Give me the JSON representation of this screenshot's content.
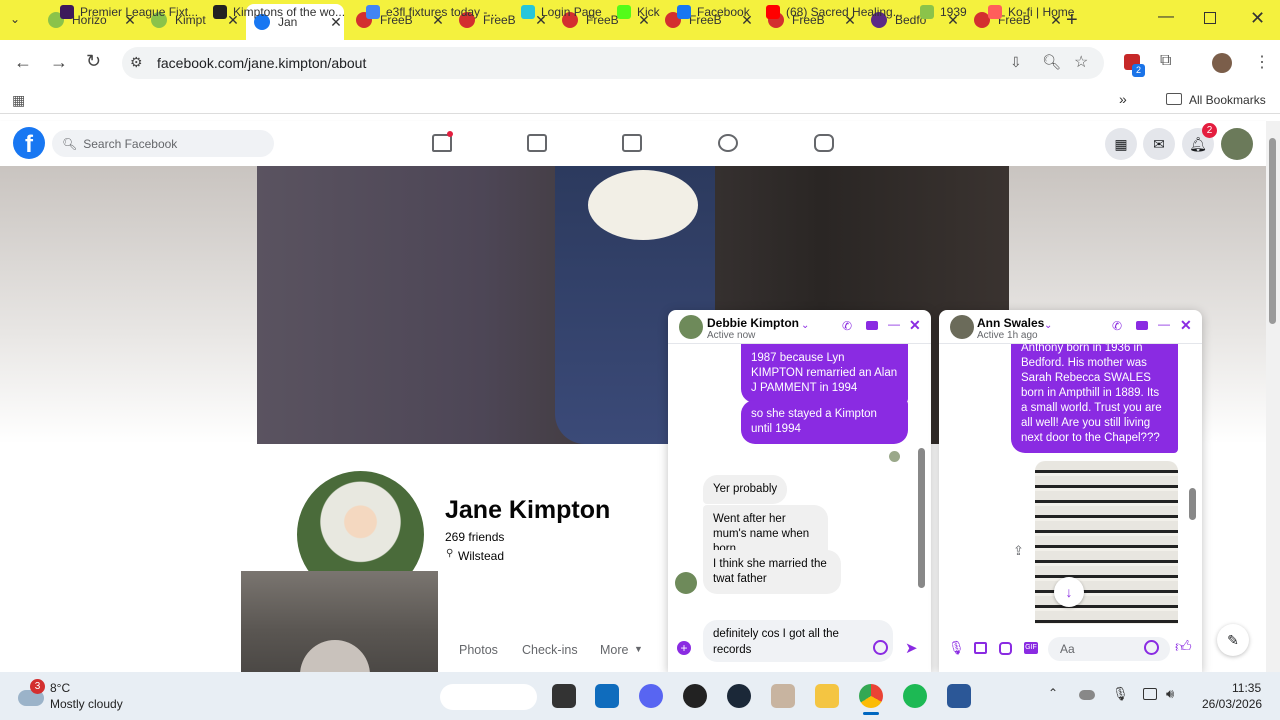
{
  "browser": {
    "tabs": [
      {
        "title": "Horizo",
        "icon": "fern-icon",
        "color": "#8bc34a"
      },
      {
        "title": "Kimpt",
        "icon": "fern-icon",
        "color": "#8bc34a"
      },
      {
        "title": "Jan",
        "icon": "facebook-icon",
        "color": "#1877f2",
        "active": true
      },
      {
        "title": "FreeB",
        "icon": "freebmd-icon",
        "color": "#d32f2f"
      },
      {
        "title": "FreeB",
        "icon": "freebmd-icon",
        "color": "#d32f2f"
      },
      {
        "title": "FreeB",
        "icon": "freebmd-icon",
        "color": "#d32f2f"
      },
      {
        "title": "FreeB",
        "icon": "freebmd-icon",
        "color": "#d32f2f"
      },
      {
        "title": "FreeB",
        "icon": "freebmd-icon",
        "color": "#d32f2f"
      },
      {
        "title": "Bedfo",
        "icon": "archive-icon",
        "color": "#5b2a86"
      },
      {
        "title": "FreeB",
        "icon": "freebmd-icon",
        "color": "#d32f2f"
      }
    ],
    "url": "facebook.com/jane.kimpton/about",
    "extension_badge": "2",
    "bookmarks": [
      {
        "label": "Premier League Fixt...",
        "color": "#3d195b"
      },
      {
        "label": "Kimptons of the wo...",
        "color": "#222"
      },
      {
        "label": "e3fl fixtures today -...",
        "color": "#4285f4"
      },
      {
        "label": "Login Page",
        "color": "#26c6da"
      },
      {
        "label": "Kick",
        "color": "#53fc18"
      },
      {
        "label": "Facebook",
        "color": "#1877f2"
      },
      {
        "label": "(68) Sacred Healing...",
        "color": "#ff0000"
      },
      {
        "label": "1939",
        "color": "#8bc34a"
      },
      {
        "label": "Ko-fi | Home",
        "color": "#ff5e5b"
      }
    ],
    "all_bookmarks": "All Bookmarks"
  },
  "facebook": {
    "search_placeholder": "Search Facebook",
    "notifications_badge": "2",
    "profile": {
      "name": "Jane Kimpton",
      "friends": "269 friends",
      "location": "Wilstead"
    },
    "profile_tabs": [
      "Photos",
      "Check-ins",
      "More"
    ]
  },
  "chat1": {
    "name": "Debbie Kimpton",
    "status": "Active now",
    "messages_out": [
      "1987 because Lyn KIMPTON remarried an Alan J PAMMENT in 1994",
      "so she stayed a Kimpton until 1994"
    ],
    "messages_in": [
      "Yer probably",
      "Went after her mum's name when born",
      "I think she married the twat father"
    ],
    "draft": "definitely cos I got all the records"
  },
  "chat2": {
    "name": "Ann Swales",
    "status": "Active 1h ago",
    "message": "Anthony born in 1936 in Bedford. His mother was Sarah Rebecca SWALES born in Ampthill in 1889. Its a small world. Trust you are all well! Are you still living next door to the Chapel???",
    "input_placeholder": "Aa"
  },
  "taskbar": {
    "weather_temp": "8°C",
    "weather_desc": "Mostly cloudy",
    "weather_badge": "3",
    "time": "11:35",
    "date": "26/03/2026"
  },
  "colors": {
    "tab_bar": "#f4f13e",
    "messenger_purple": "#8a2be2",
    "facebook_blue": "#1877f2"
  }
}
